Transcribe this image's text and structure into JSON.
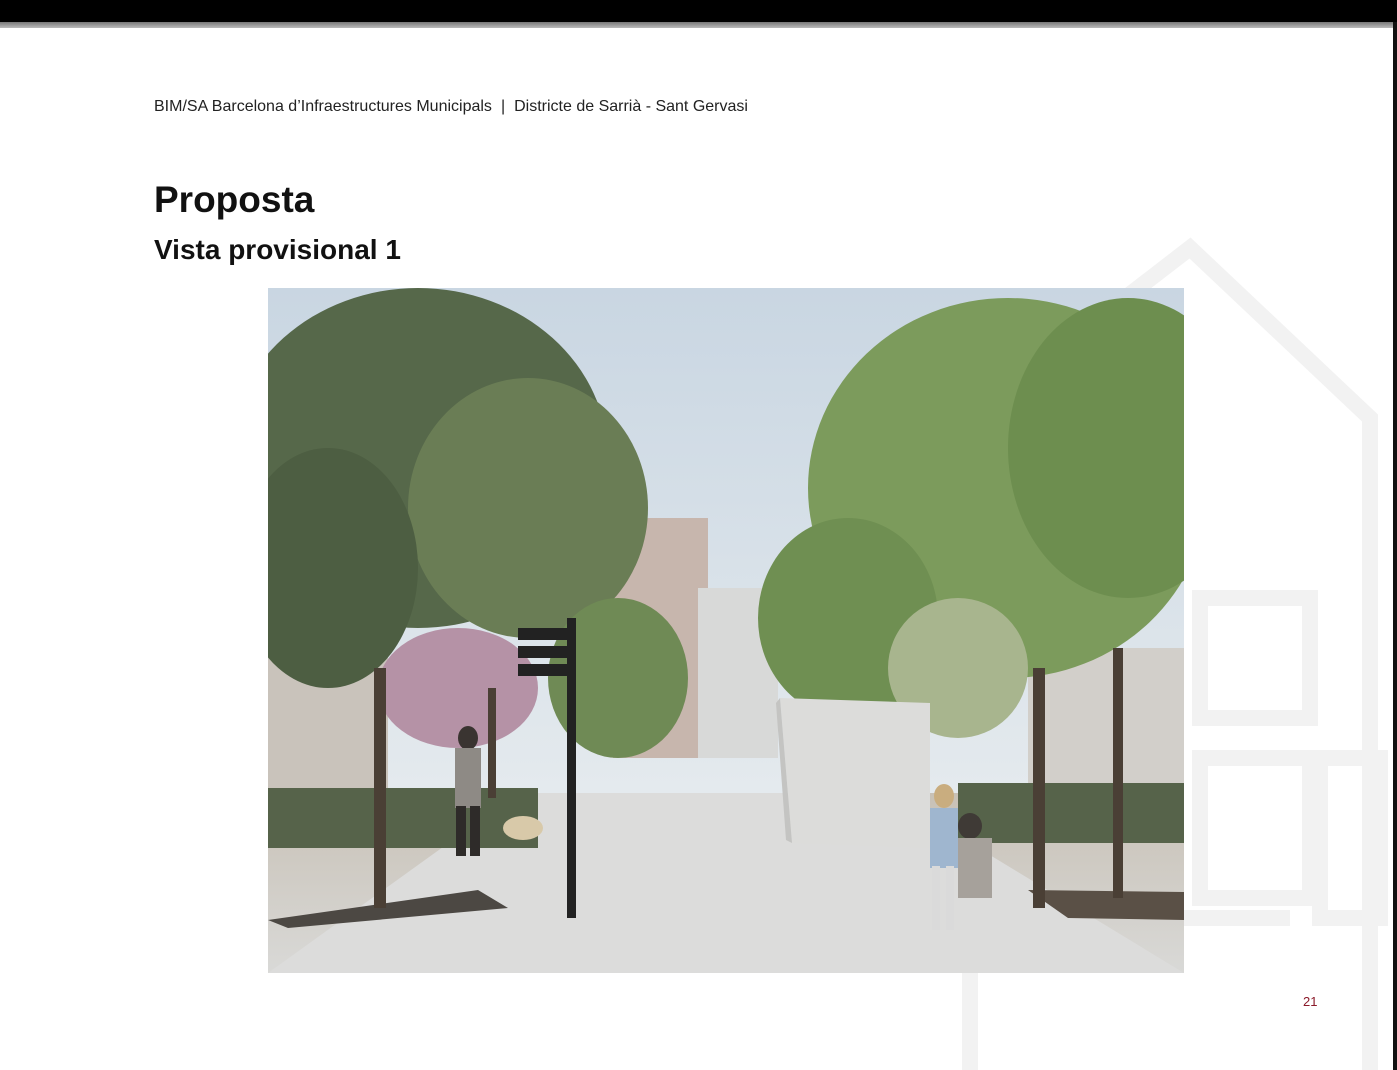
{
  "slide": {
    "header": {
      "organization": "BIM/SA Barcelona d’Infraestructures Municipals",
      "separator": "|",
      "district": "Districte de Sarrià - Sant Gervasi"
    },
    "title": "Proposta",
    "subtitle": "Vista provisional 1",
    "page_number": "21"
  },
  "image": {
    "icon": "architectural-render-icon"
  },
  "colors": {
    "page_number": "#8b1a2a",
    "title": "#111111"
  }
}
